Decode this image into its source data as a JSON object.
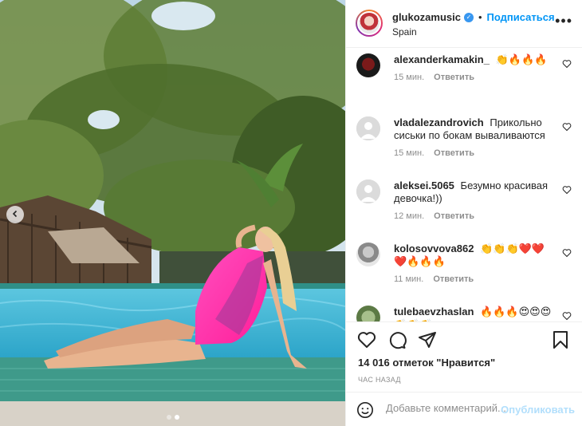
{
  "post": {
    "username": "glukozamusic",
    "follow_label": "Подписаться",
    "location": "Spain",
    "dot": "•",
    "more_icon": "more-horizontal-icon"
  },
  "comments": [
    {
      "user": "alexanderkamakin_",
      "text": "👏🔥🔥🔥",
      "time": "15 мин.",
      "reply": "Ответить"
    },
    {
      "user": "vladalezandrovich",
      "text": "Прикольно сиськи по бокам вываливаются",
      "time": "15 мин.",
      "reply": "Ответить"
    },
    {
      "user": "aleksei.5065",
      "text": "Безумно красивая девочка!))",
      "time": "12 мин.",
      "reply": "Ответить"
    },
    {
      "user": "kolosovvova862",
      "text": "👏👏👏❤️❤️❤️🔥🔥🔥",
      "time": "11 мин.",
      "reply": "Ответить"
    },
    {
      "user": "tulebaevzhaslan",
      "text": "🔥🔥🔥😍😍😍👏👏👏",
      "time": "",
      "reply": ""
    }
  ],
  "actions": {
    "likes": "14 016 отметок \"Нравится\"",
    "time": "ЧАС НАЗАД"
  },
  "add_comment": {
    "placeholder": "Добавьте комментарий...",
    "post_label": "Опубликовать"
  },
  "colors": {
    "accent": "#0095f6",
    "swimsuit": "#ff2aa8",
    "pool": "#3fb4d6"
  }
}
